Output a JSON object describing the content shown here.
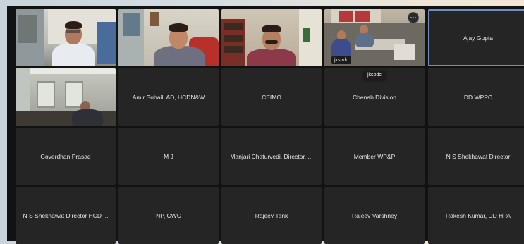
{
  "participants": [
    {
      "id": "p1",
      "video": true,
      "name": ""
    },
    {
      "id": "p2",
      "video": true,
      "name": ""
    },
    {
      "id": "p3",
      "video": true,
      "name": ""
    },
    {
      "id": "p4",
      "video": true,
      "name": "jkspdc"
    },
    {
      "id": "p5",
      "video": false,
      "name": "Ajay Gupta",
      "active": true
    },
    {
      "id": "p6",
      "video": true,
      "name": ""
    },
    {
      "id": "p7",
      "video": false,
      "name": "Amir Suhail, AD, HCDN&W"
    },
    {
      "id": "p8",
      "video": false,
      "name": "CEIMO"
    },
    {
      "id": "p9",
      "video": false,
      "name": "Chenab Division"
    },
    {
      "id": "p10",
      "video": false,
      "name": "DD WPPC"
    },
    {
      "id": "p11",
      "video": false,
      "name": "Goverdhan Prasad"
    },
    {
      "id": "p12",
      "video": false,
      "name": "M J"
    },
    {
      "id": "p13",
      "video": false,
      "name": "Manjari Chaturvedi, Director, ..."
    },
    {
      "id": "p14",
      "video": false,
      "name": "Member WP&P"
    },
    {
      "id": "p15",
      "video": false,
      "name": "N S Shekhawat Director"
    },
    {
      "id": "p16",
      "video": false,
      "name": "N S Shekhawat Director HCD ..."
    },
    {
      "id": "p17",
      "video": false,
      "name": "NP, CWC"
    },
    {
      "id": "p18",
      "video": false,
      "name": "Rajeev Tank"
    },
    {
      "id": "p19",
      "video": false,
      "name": "Rajeev Varshney"
    },
    {
      "id": "p20",
      "video": false,
      "name": "Rakesh Kumar, DD HPA"
    }
  ],
  "hover_tooltip": "jkspdc",
  "more_options_icon": "ellipsis-icon",
  "colors": {
    "tile_bg": "#252525",
    "window_bg": "#121212",
    "active_border": "#6f8fbf"
  }
}
